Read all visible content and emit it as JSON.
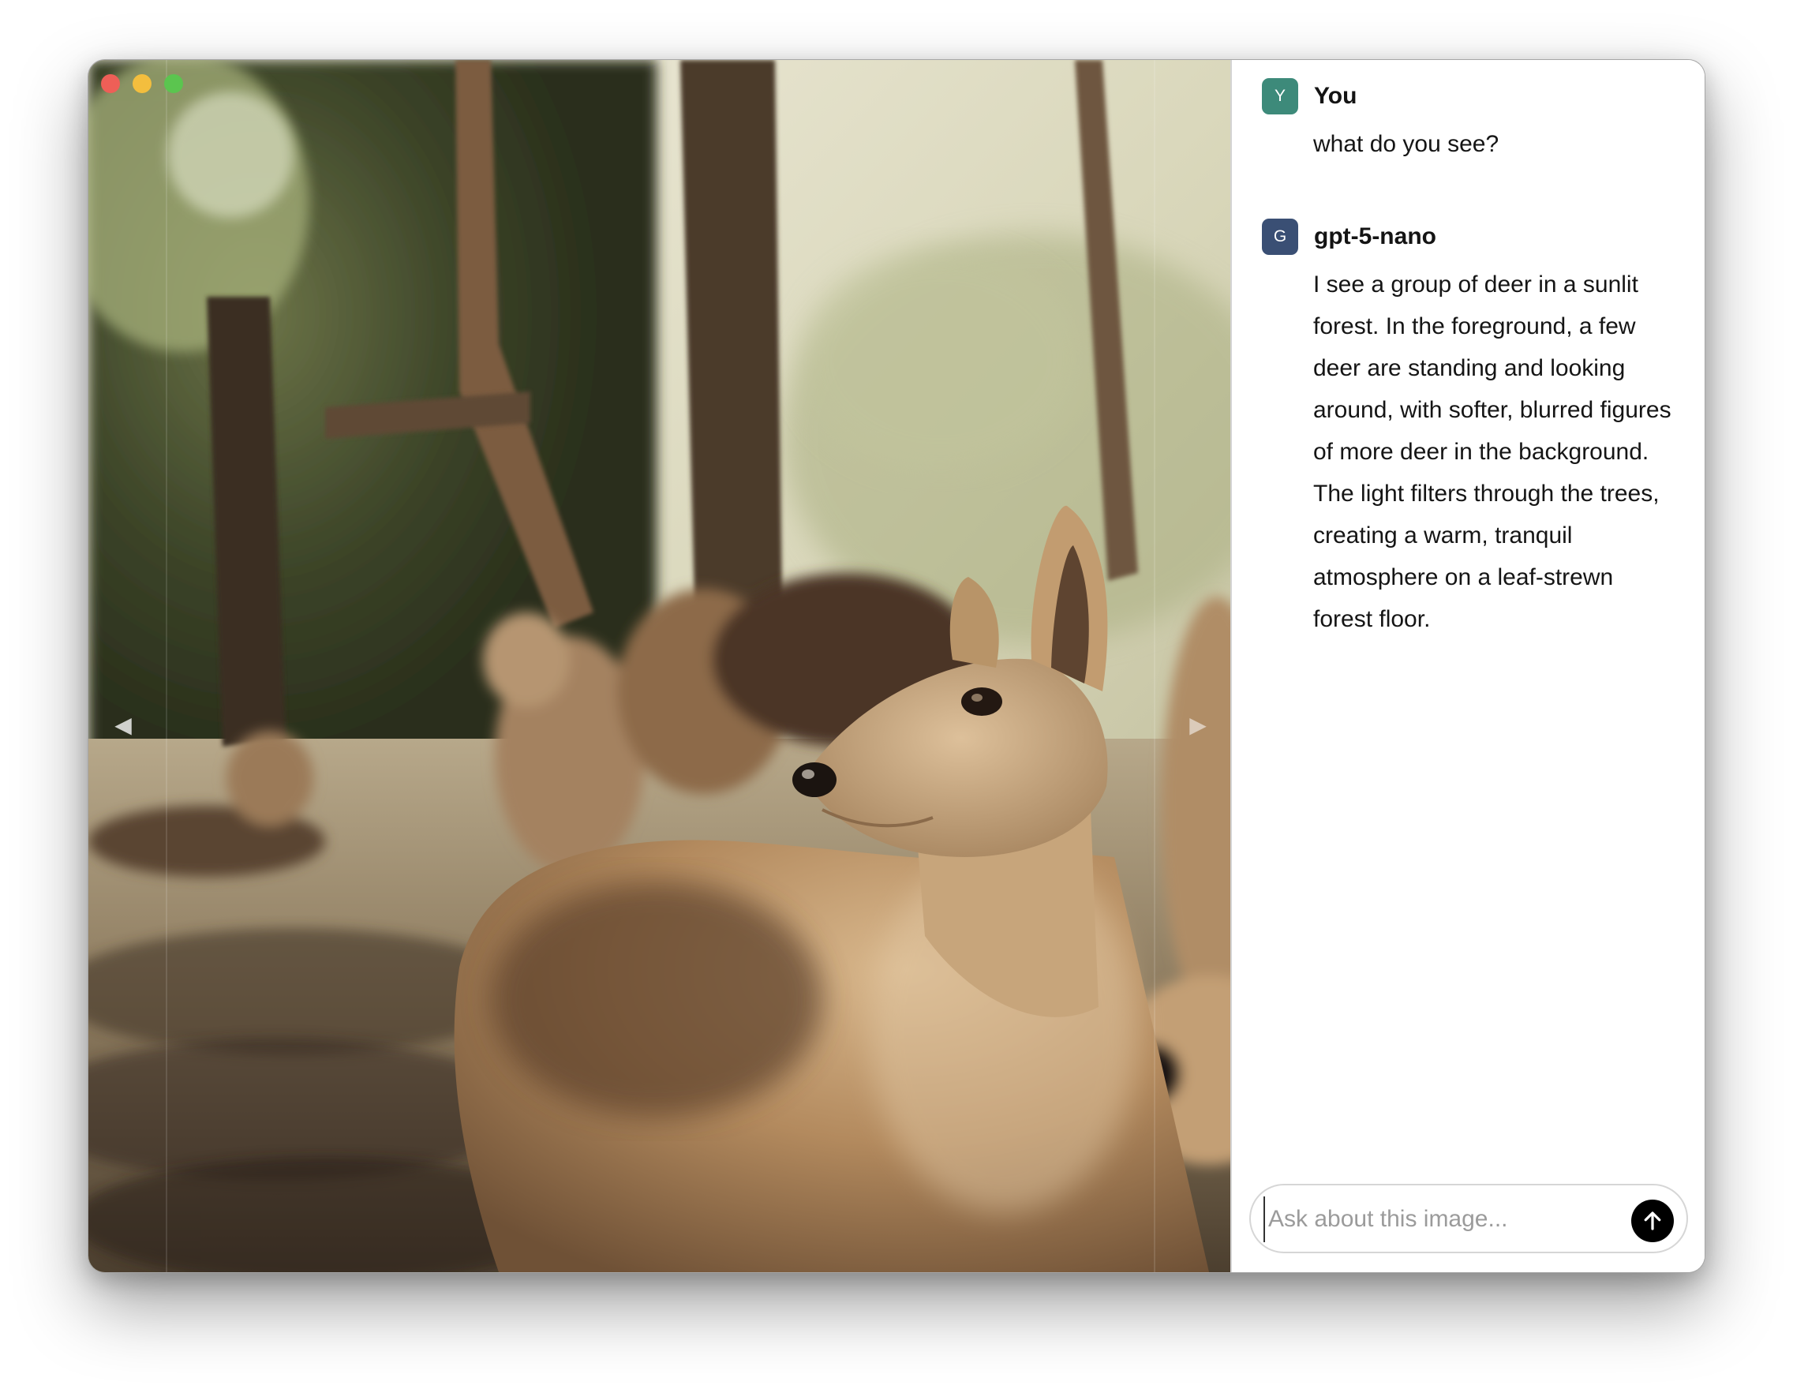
{
  "window": {
    "controls": [
      "close",
      "minimize",
      "zoom"
    ]
  },
  "viewer": {
    "prev_icon": "◀",
    "next_icon": "▶",
    "image_alt_icon": "deer-photo"
  },
  "chat": {
    "messages": [
      {
        "avatar_letter": "Y",
        "avatar_color": "#3d8a7a",
        "sender": "You",
        "text": "what do you see?"
      },
      {
        "avatar_letter": "G",
        "avatar_color": "#3a4f74",
        "sender": "gpt-5-nano",
        "text": "I see a group of deer in a sunlit forest. In the foreground, a few deer are standing and looking around, with softer, blurred figures of more deer in the background. The light filters through the trees, creating a warm, tranquil atmosphere on a leaf-strewn forest floor."
      }
    ],
    "composer": {
      "placeholder": "Ask about this image...",
      "value": "",
      "send_icon": "arrow-up-icon"
    }
  }
}
